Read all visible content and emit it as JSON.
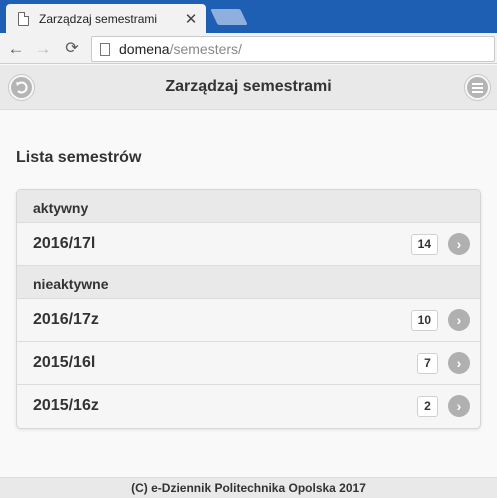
{
  "browser": {
    "tab_title": "Zarządzaj semestrami",
    "tab_close": "✕",
    "url_host": "domena",
    "url_path": "/semesters/"
  },
  "header": {
    "title": "Zarządzaj semestrami"
  },
  "section_title": "Lista semestrów",
  "groups": [
    {
      "label": "aktywny",
      "items": [
        {
          "label": "2016/17l",
          "count": "14"
        }
      ]
    },
    {
      "label": "nieaktywne",
      "items": [
        {
          "label": "2016/17z",
          "count": "10"
        },
        {
          "label": "2015/16l",
          "count": "7"
        },
        {
          "label": "2015/16z",
          "count": "2"
        }
      ]
    }
  ],
  "footer": "(C) e-Dziennik Politechnika Opolska 2017",
  "icons": {
    "back": "back-icon",
    "menu": "menu-icon",
    "arrow": "chevron-right-icon"
  }
}
